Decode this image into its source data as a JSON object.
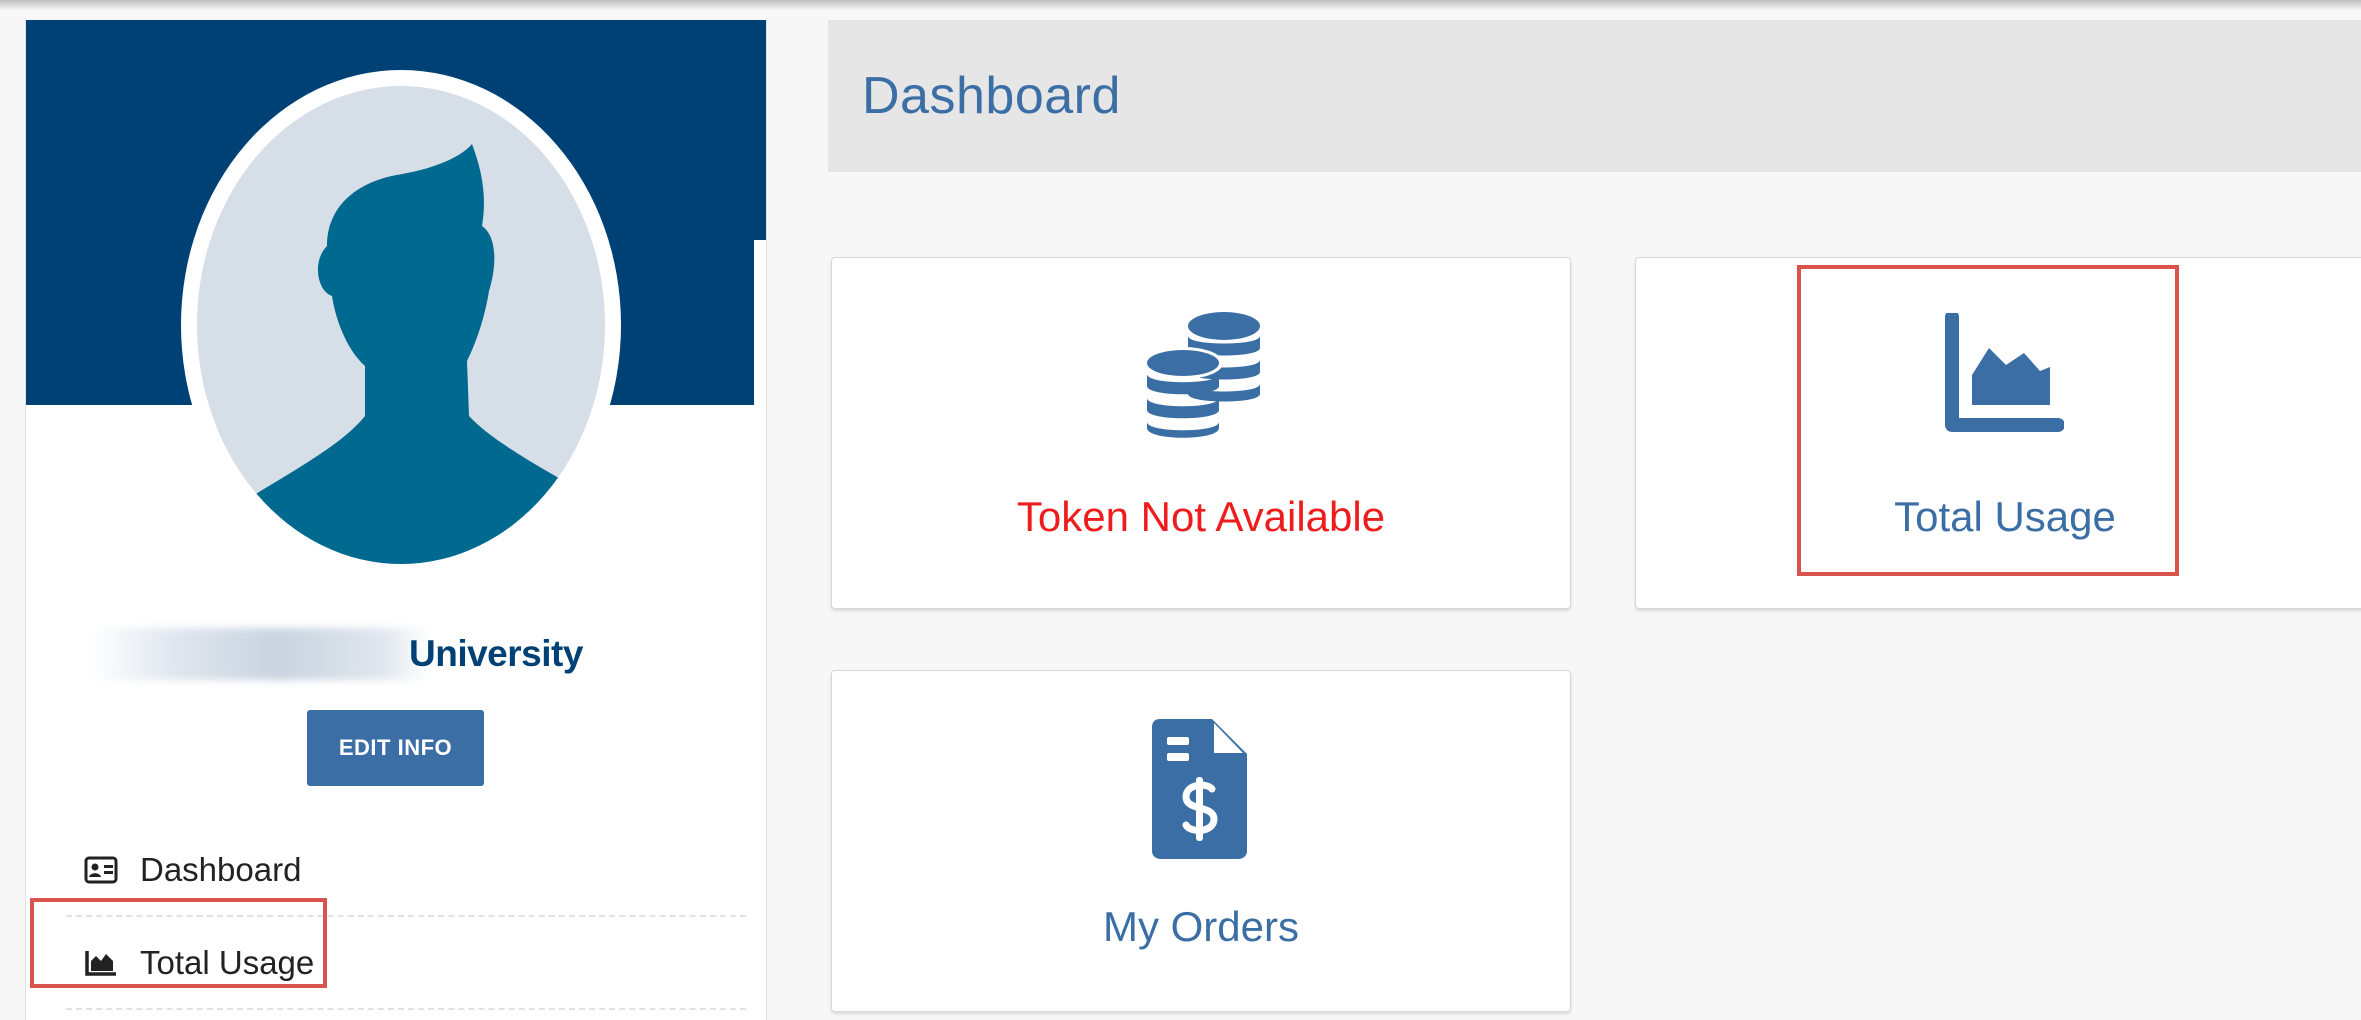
{
  "sidebar": {
    "org_name": "University",
    "edit_button": "EDIT INFO",
    "items": [
      {
        "label": "Dashboard",
        "icon": "id-card-icon"
      },
      {
        "label": "Total Usage",
        "icon": "area-chart-icon"
      }
    ]
  },
  "main": {
    "title": "Dashboard",
    "cards": [
      {
        "label": "Token Not Available",
        "icon": "coins-icon",
        "color": "#ee1d1d"
      },
      {
        "label": "Total Usage",
        "icon": "area-chart-icon",
        "color": "#3b6ea5"
      },
      {
        "label": "My Orders",
        "icon": "invoice-dollar-icon",
        "color": "#3b6ea5"
      }
    ]
  },
  "colors": {
    "brand_dark": "#004175",
    "accent": "#3b6ea5",
    "highlight": "#d9534f",
    "error": "#ee1d1d"
  }
}
